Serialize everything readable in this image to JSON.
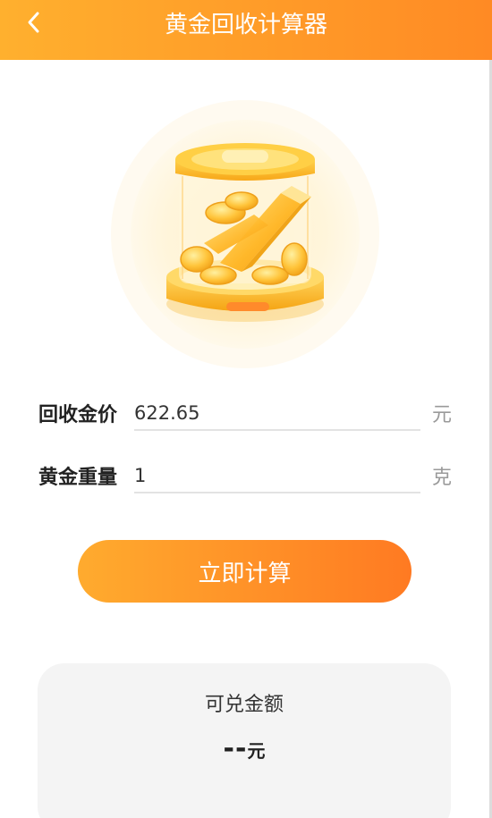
{
  "header": {
    "title": "黄金回收计算器",
    "back_icon": "chevron-left-icon"
  },
  "form": {
    "price": {
      "label": "回收金价",
      "value": "622.65",
      "unit": "元"
    },
    "weight": {
      "label": "黄金重量",
      "value": "1",
      "unit": "克"
    }
  },
  "button": {
    "label": "立即计算"
  },
  "result": {
    "label": "可兑金额",
    "value": "--",
    "unit": "元"
  },
  "colors": {
    "accent_start": "#ffb02e",
    "accent_end": "#ff8a24",
    "card_bg": "#f4f4f4"
  }
}
